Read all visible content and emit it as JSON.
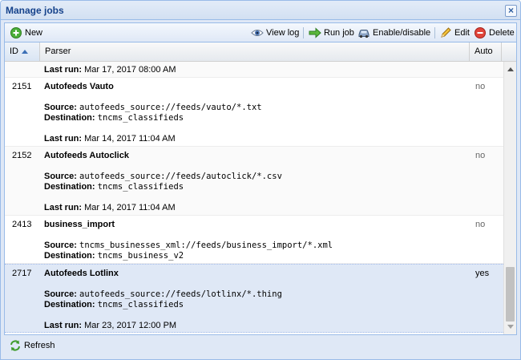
{
  "window": {
    "title": "Manage jobs"
  },
  "toolbar": {
    "new_label": "New",
    "view_log_label": "View log",
    "run_job_label": "Run job",
    "enable_disable_label": "Enable/disable",
    "edit_label": "Edit",
    "delete_label": "Delete"
  },
  "grid": {
    "columns": {
      "id": "ID",
      "parser": "Parser",
      "auto": "Auto"
    },
    "sort": {
      "column": "ID",
      "direction": "ascending"
    },
    "labels": {
      "source": "Source:",
      "destination": "Destination:",
      "last_run": "Last run:"
    },
    "partial_row": {
      "last_run": "Mar 17, 2017 08:00 AM"
    },
    "rows": [
      {
        "id": "2151",
        "name": "Autofeeds Vauto",
        "source": "autofeeds_source://feeds/vauto/*.txt",
        "destination": "tncms_classifieds",
        "last_run": "Mar 14, 2017 11:04 AM",
        "auto": "no"
      },
      {
        "id": "2152",
        "name": "Autofeeds Autoclick",
        "source": "autofeeds_source://feeds/autoclick/*.csv",
        "destination": "tncms_classifieds",
        "last_run": "Mar 14, 2017 11:04 AM",
        "auto": "no"
      },
      {
        "id": "2413",
        "name": "business_import",
        "source": "tncms_businesses_xml://feeds/business_import/*.xml",
        "destination": "tncms_business_v2",
        "last_run": "",
        "auto": "no"
      },
      {
        "id": "2717",
        "name": "Autofeeds Lotlinx",
        "source": "autofeeds_source://feeds/lotlinx/*.thing",
        "destination": "tncms_classifieds",
        "last_run": "Mar 23, 2017 12:00 PM",
        "auto": "yes",
        "selected": true
      }
    ]
  },
  "footer": {
    "refresh_label": "Refresh"
  },
  "icons": {
    "new": "add-circle-icon",
    "view_log": "eye-icon",
    "run_job": "arrow-right-icon",
    "enable_disable": "car-icon",
    "edit": "pencil-icon",
    "delete": "delete-circle-icon",
    "refresh": "refresh-icon",
    "close": "close-icon"
  },
  "colors": {
    "title_text": "#15428b",
    "border": "#99bbe8",
    "selection": "#dfe8f6",
    "add_green": "#3e9b2a",
    "delete_red": "#d9312b"
  }
}
